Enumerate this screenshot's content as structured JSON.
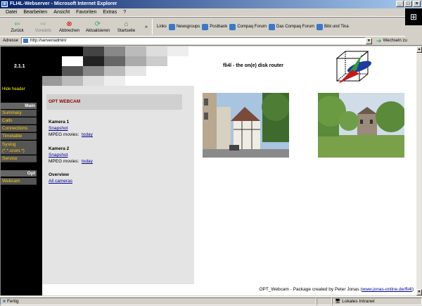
{
  "window": {
    "title": "FLI4L-Webserver - Microsoft Internet Explorer",
    "buttons": [
      "_",
      "□",
      "×"
    ]
  },
  "menu": [
    "Datei",
    "Bearbeiten",
    "Ansicht",
    "Favoriten",
    "Extras",
    "?"
  ],
  "toolbar": {
    "back": "Zurück",
    "forward": "Vorwärts",
    "stop": "Abbrechen",
    "refresh": "Aktualisieren",
    "home": "Startseite",
    "more": "»",
    "links_label": "Links",
    "links": [
      "Newsgroups",
      "Postbank",
      "Compaq Forum",
      "Das Compaq Forum",
      "Bibi und Tina"
    ]
  },
  "address": {
    "label": "Adresse",
    "url": "http://server/admin/",
    "go": "Wechseln zu"
  },
  "page": {
    "version": "2.1.1",
    "title": "fli4l - the on(e) disk router",
    "hide_header": "Hide header",
    "nav_main_label": "Main",
    "nav_main": [
      "Summary",
      "Calls",
      "Connections",
      "Timetable",
      "Syslog (*.*.crom.*)",
      "Service"
    ],
    "nav_opt_label": "Opt",
    "nav_opt": [
      "Webcam"
    ],
    "section_title": "OPT WEBCAM",
    "cameras": [
      {
        "name": "Kamera 1",
        "snapshot": "Snapshot",
        "mpeg_label": "MPEG movies:",
        "today": "today"
      },
      {
        "name": "Kamera 2",
        "snapshot": "Snapshot",
        "mpeg_label": "MPEG movies:",
        "today": "today"
      }
    ],
    "overview": {
      "title": "Overview",
      "link": "All cameras"
    },
    "footer_text": "OPT_Webcam - Package created by Peter Jonas (",
    "footer_link": "www.jonas-online.de/fli4l",
    "footer_end": ")"
  },
  "status": {
    "left": "Fertig",
    "zone": "Lokales Intranet"
  }
}
